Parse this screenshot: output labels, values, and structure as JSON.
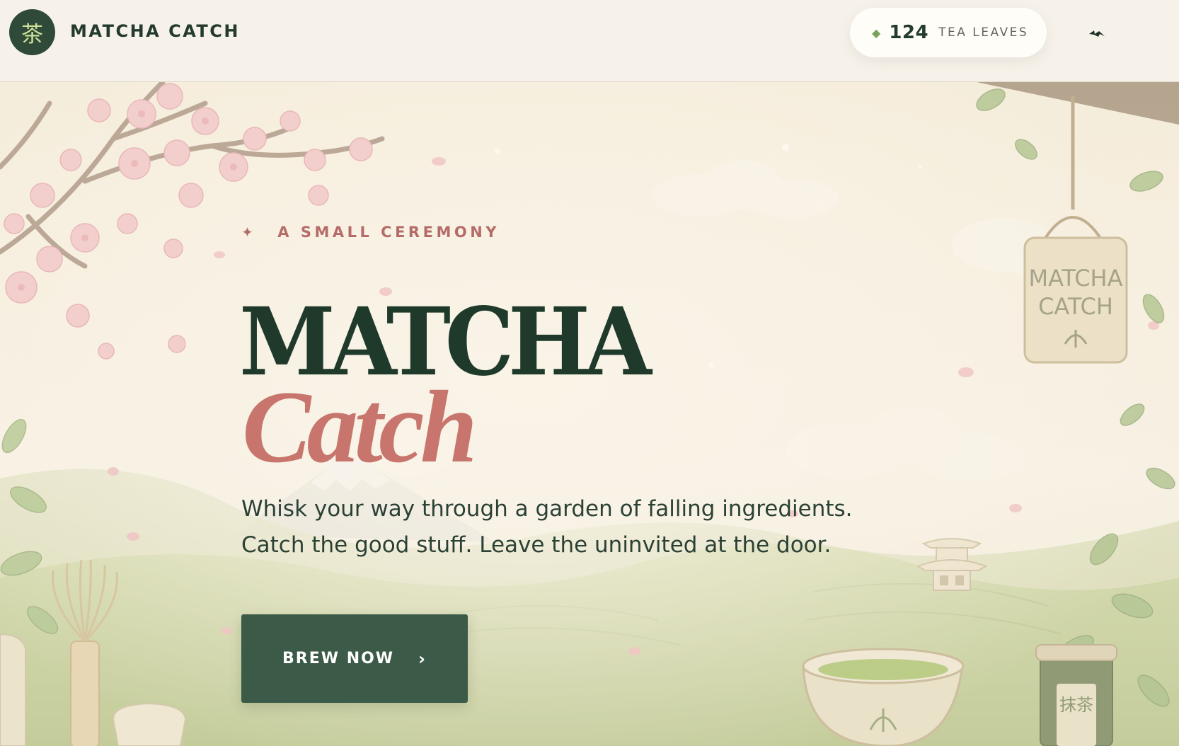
{
  "header": {
    "logo_glyph": "茶",
    "brand": "MATCHA CATCH",
    "counter": {
      "icon": "leaf-diamond-icon",
      "value": "124",
      "label": "TEA LEAVES"
    },
    "sound_icon": "sound-toggle-icon"
  },
  "hero": {
    "eyebrow_icon": "✦",
    "eyebrow": "A SMALL CEREMONY",
    "title_line1": "MATCHA",
    "title_line2": "Catch",
    "tagline": "Whisk your way through a garden of falling ingredients. Catch the good stuff. Leave the uninvited at the door.",
    "cta_label": "BREW NOW",
    "cta_arrow": "›"
  },
  "scene": {
    "sign_line1": "MATCHA",
    "sign_line2": "CATCH",
    "tin_label": "抹茶"
  },
  "colors": {
    "accent_green": "#3b5a47",
    "deep_green": "#1f3a2b",
    "rose": "#c8766d",
    "cream": "#f7f2e7"
  }
}
